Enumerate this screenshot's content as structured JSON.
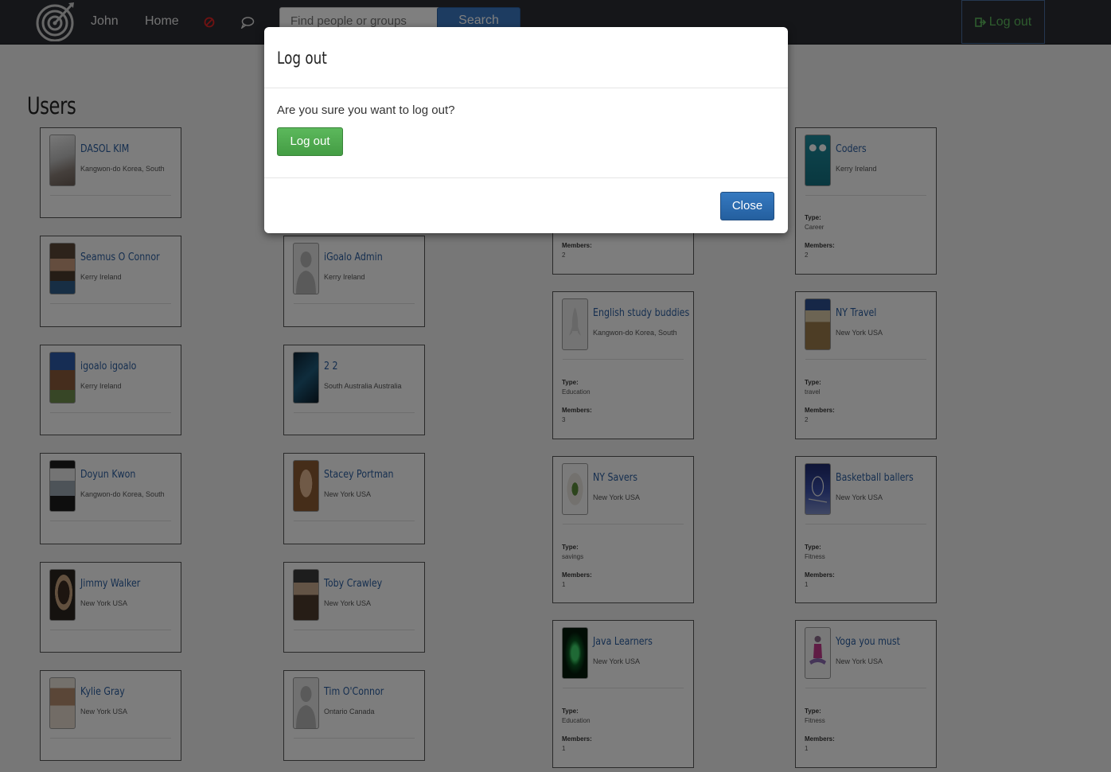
{
  "navbar": {
    "user_name": "John",
    "home_label": "Home",
    "search_placeholder": "Find people or groups",
    "search_button": "Search",
    "logout_label": "Log out"
  },
  "page": {
    "title": "Users"
  },
  "users": [
    {
      "name": "DASOL KIM",
      "location": "Kangwon-do Korea, South"
    },
    {
      "name": "Seamus O Connor",
      "location": "Kerry Ireland"
    },
    {
      "name": "igoalo igoalo",
      "location": "Kerry Ireland"
    },
    {
      "name": "Doyun Kwon",
      "location": "Kangwon-do Korea, South"
    },
    {
      "name": "Jimmy Walker",
      "location": "New York USA"
    },
    {
      "name": "Kylie Gray",
      "location": "New York USA"
    },
    {
      "name": "iGoalo Admin",
      "location": "Kerry Ireland"
    },
    {
      "name": "2 2",
      "location": "South Australia Australia"
    },
    {
      "name": "Stacey Portman",
      "location": "New York USA"
    },
    {
      "name": "Toby Crawley",
      "location": "New York USA"
    },
    {
      "name": "Tim O'Connor",
      "location": "Ontario Canada"
    }
  ],
  "groups": [
    {
      "members_label": "Members:",
      "members": "2"
    },
    {
      "name": "English study buddies",
      "location": "Kangwon-do Korea, South",
      "type_label": "Type:",
      "type": "Education",
      "members_label": "Members:",
      "members": "3"
    },
    {
      "name": "NY Savers",
      "location": "New York USA",
      "type_label": "Type:",
      "type": "savings",
      "members_label": "Members:",
      "members": "1"
    },
    {
      "name": "Java Learners",
      "location": "New York USA",
      "type_label": "Type:",
      "type": "Education",
      "members_label": "Members:",
      "members": "1"
    },
    {
      "name": "Coders",
      "location": "Kerry Ireland",
      "type_label": "Type:",
      "type": "Career",
      "members_label": "Members:",
      "members": "2"
    },
    {
      "name": "NY Travel",
      "location": "New York USA",
      "type_label": "Type:",
      "type": "travel",
      "members_label": "Members:",
      "members": "2"
    },
    {
      "name": "Basketball ballers",
      "location": "New York USA",
      "type_label": "Type:",
      "type": "Fitness",
      "members_label": "Members:",
      "members": "1"
    },
    {
      "name": "Yoga you must",
      "location": "New York USA",
      "type_label": "Type:",
      "type": "Fitness",
      "members_label": "Members:",
      "members": "1"
    }
  ],
  "modal": {
    "title": "Log out",
    "message": "Are you sure you want to log out?",
    "confirm_label": "Log out",
    "close_label": "Close"
  },
  "colors": {
    "navbar": "#2b2d33",
    "link": "#2a5d9f",
    "success": "#5cb85c",
    "primary": "#2e6da4"
  }
}
